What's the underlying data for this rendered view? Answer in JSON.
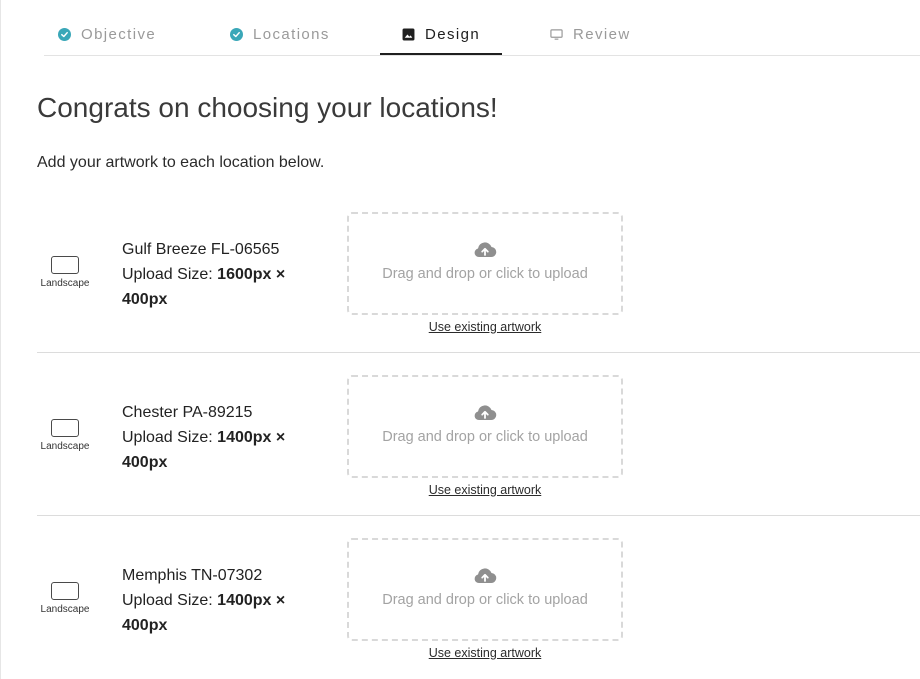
{
  "stepper": {
    "steps": [
      {
        "label": "Objective",
        "icon": "check-circle-icon",
        "state": "done"
      },
      {
        "label": "Locations",
        "icon": "check-circle-icon",
        "state": "done"
      },
      {
        "label": "Design",
        "icon": "image-icon",
        "state": "active"
      },
      {
        "label": "Review",
        "icon": "monitor-icon",
        "state": "upcoming"
      }
    ],
    "accent_color": "#3aa7b8"
  },
  "page": {
    "title": "Congrats on choosing your locations!",
    "subtitle": "Add your artwork to each location below."
  },
  "locations": [
    {
      "orientation_label": "Landscape",
      "name": "Gulf Breeze FL-06565",
      "size_label": "Upload Size:",
      "size_value": "1600px × 400px",
      "dropzone_text": "Drag and drop or click to upload",
      "existing_link": "Use existing artwork"
    },
    {
      "orientation_label": "Landscape",
      "name": "Chester PA-89215",
      "size_label": "Upload Size:",
      "size_value": "1400px × 400px",
      "dropzone_text": "Drag and drop or click to upload",
      "existing_link": "Use existing artwork"
    },
    {
      "orientation_label": "Landscape",
      "name": "Memphis TN-07302",
      "size_label": "Upload Size:",
      "size_value": "1400px × 400px",
      "dropzone_text": "Drag and drop or click to upload",
      "existing_link": "Use existing artwork"
    }
  ]
}
